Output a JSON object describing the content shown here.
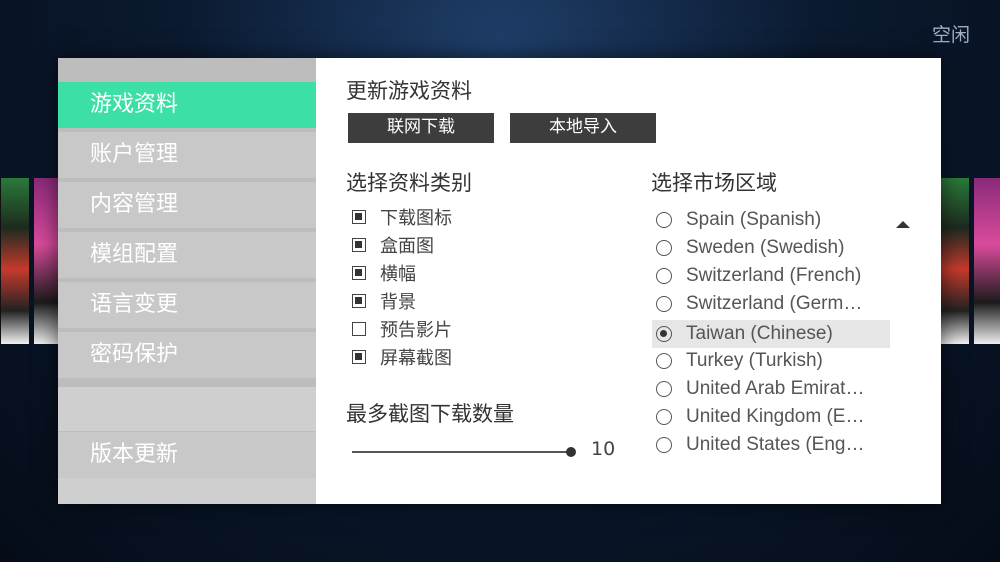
{
  "status": "空闲",
  "sidebar": {
    "items": [
      {
        "label": "游戏资料",
        "active": true
      },
      {
        "label": "账户管理",
        "active": false
      },
      {
        "label": "内容管理",
        "active": false
      },
      {
        "label": "模组配置",
        "active": false
      },
      {
        "label": "语言变更",
        "active": false
      },
      {
        "label": "密码保护",
        "active": false
      }
    ],
    "footer_item": "版本更新"
  },
  "main": {
    "update_title": "更新游戏资料",
    "buttons": {
      "online": "联网下载",
      "local": "本地导入"
    },
    "category_title": "选择资料类别",
    "categories": [
      {
        "label": "下载图标",
        "checked": true
      },
      {
        "label": "盒面图",
        "checked": true
      },
      {
        "label": "横幅",
        "checked": true
      },
      {
        "label": "背景",
        "checked": true
      },
      {
        "label": "预告影片",
        "checked": false
      },
      {
        "label": "屏幕截图",
        "checked": true
      }
    ],
    "max_screenshots_title": "最多截图下载数量",
    "max_screenshots_value": "10",
    "region_title": "选择市场区域",
    "regions": [
      {
        "label": "Spain (Spanish)",
        "selected": false
      },
      {
        "label": "Sweden (Swedish)",
        "selected": false
      },
      {
        "label": "Switzerland (French)",
        "selected": false
      },
      {
        "label": "Switzerland (Germ…",
        "selected": false
      },
      {
        "label": "Taiwan (Chinese)",
        "selected": true
      },
      {
        "label": "Turkey (Turkish)",
        "selected": false
      },
      {
        "label": "United Arab Emirat…",
        "selected": false
      },
      {
        "label": "United Kingdom (E…",
        "selected": false
      },
      {
        "label": "United States (Eng…",
        "selected": false
      }
    ]
  },
  "colors": {
    "accent": "#3de0a4",
    "button_bg": "#3d3d3d",
    "sidebar_bg": "#c8c8c8"
  }
}
